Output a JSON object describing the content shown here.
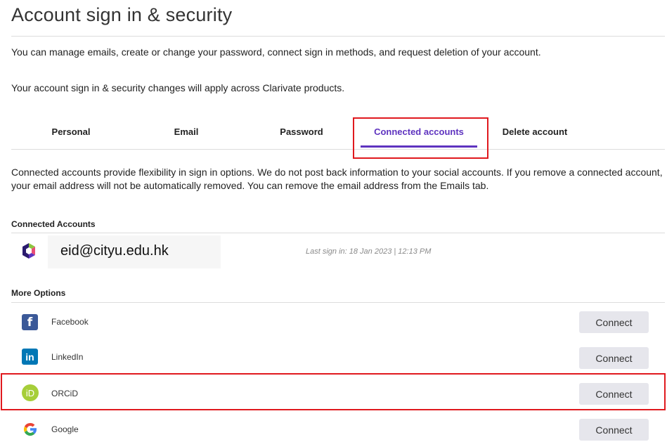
{
  "header": {
    "title": "Account sign in & security",
    "intro_1": "You can manage emails, create or change your password, connect sign in methods, and request deletion of your account.",
    "intro_2": "Your account sign in & security changes will apply across Clarivate products."
  },
  "tabs": [
    {
      "label": "Personal"
    },
    {
      "label": "Email"
    },
    {
      "label": "Password"
    },
    {
      "label": "Connected accounts"
    },
    {
      "label": "Delete account"
    }
  ],
  "description": "Connected accounts provide flexibility in sign in options. We do not post back information to your social accounts. If you remove a connected account, your email address will not be automatically removed. You can remove the email address from the Emails tab.",
  "connected": {
    "heading": "Connected Accounts",
    "account": {
      "email": "eid@cityu.edu.hk",
      "last_sign_in": "Last sign in: 18 Jan 2023 | 12:13 PM",
      "icon": "clarivate-logo-icon"
    }
  },
  "more_options": {
    "heading": "More Options",
    "items": [
      {
        "label": "Facebook",
        "button": "Connect",
        "icon": "facebook-icon",
        "color": "#3b5998"
      },
      {
        "label": "LinkedIn",
        "button": "Connect",
        "icon": "linkedin-icon",
        "color": "#0077b5"
      },
      {
        "label": "ORCiD",
        "button": "Connect",
        "icon": "orcid-icon",
        "color": "#a6ce39"
      },
      {
        "label": "Google",
        "button": "Connect",
        "icon": "google-icon",
        "color": "#4285f4"
      }
    ]
  },
  "colors": {
    "accent": "#5e33bf",
    "highlight": "#e0191e",
    "button_bg": "#e6e6ec"
  }
}
